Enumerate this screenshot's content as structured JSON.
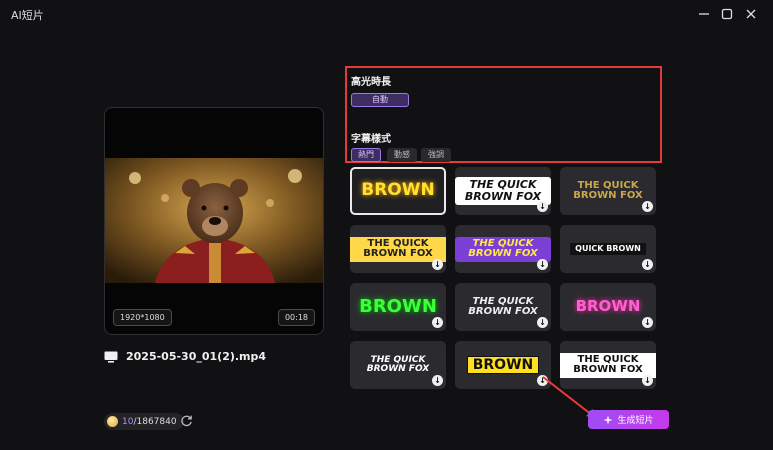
{
  "app": {
    "title": "AI短片"
  },
  "window_controls": [
    "minimize-icon",
    "maximize-icon",
    "close-icon"
  ],
  "preview": {
    "resolution": "1920*1080",
    "duration": "00:18",
    "filename": "2025-05-30_01(2).mp4"
  },
  "credits": {
    "used": "10",
    "total": "/1867840"
  },
  "settings": {
    "highlight_duration_label": "高光時長",
    "highlight_duration_value": "自動",
    "subtitle_style_label": "字幕樣式",
    "tabs": [
      "熱門",
      "動感",
      "強調"
    ],
    "active_tab": "熱門"
  },
  "styles": [
    {
      "text": "BROWN",
      "downloadable": false,
      "selected": true
    },
    {
      "text": "THE QUICK BROWN FOX",
      "downloadable": true
    },
    {
      "text": "THE QUICK BROWN FOX",
      "downloadable": true
    },
    {
      "text": "THE QUICK BROWN FOX",
      "downloadable": true
    },
    {
      "text": "THE QUICK BROWN FOX",
      "downloadable": true
    },
    {
      "text": "QUICK BROWN",
      "downloadable": true
    },
    {
      "text": "BROWN",
      "downloadable": true
    },
    {
      "text": "THE QUICK BROWN FOX",
      "downloadable": true
    },
    {
      "text": "BROWN",
      "downloadable": true
    },
    {
      "text": "THE QUICK BROWN FOX",
      "downloadable": true
    },
    {
      "text": "BROWN",
      "downloadable": true
    },
    {
      "text": "THE QUICK BROWN FOX",
      "downloadable": true
    }
  ],
  "generate_button": {
    "label": "生成短片"
  },
  "colors": {
    "accent": "#a34cf0",
    "highlight_border": "#e03c3c",
    "background": "#111113"
  }
}
